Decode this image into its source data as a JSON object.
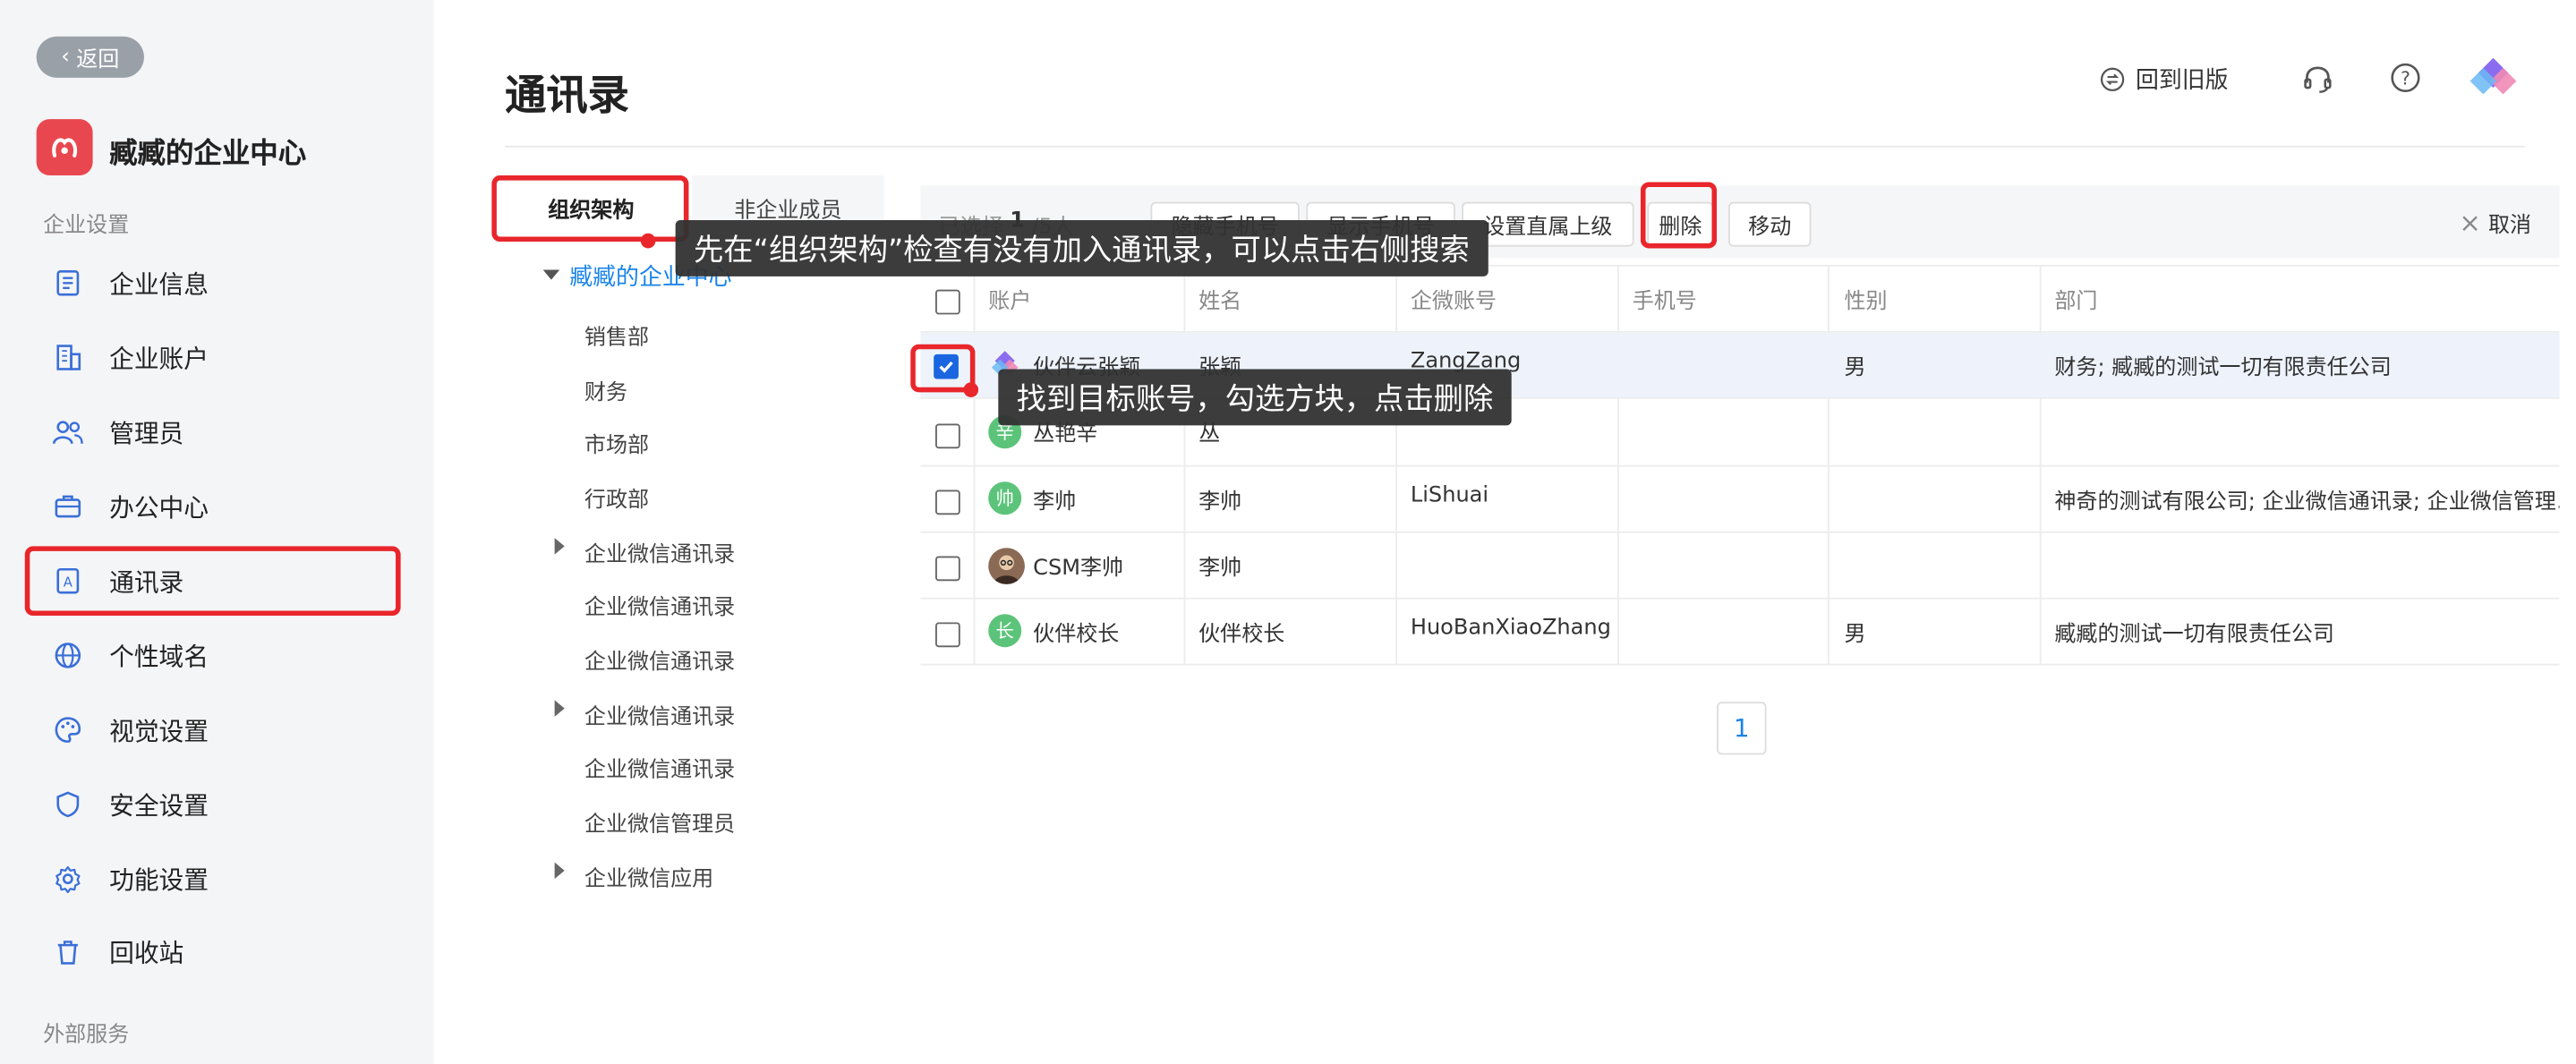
{
  "sidebar": {
    "back_label": "返回",
    "org_name": "臧臧的企业中心",
    "section_settings": "企业设置",
    "section_external": "外部服务",
    "items": [
      {
        "label": "企业信息",
        "icon": "document-icon"
      },
      {
        "label": "企业账户",
        "icon": "building-icon"
      },
      {
        "label": "管理员",
        "icon": "users-icon"
      },
      {
        "label": "办公中心",
        "icon": "briefcase-icon"
      },
      {
        "label": "通讯录",
        "icon": "contacts-book-icon",
        "active": true
      },
      {
        "label": "个性域名",
        "icon": "globe-icon"
      },
      {
        "label": "视觉设置",
        "icon": "palette-icon"
      },
      {
        "label": "安全设置",
        "icon": "shield-icon"
      },
      {
        "label": "功能设置",
        "icon": "gear-icon"
      },
      {
        "label": "回收站",
        "icon": "trash-icon"
      }
    ]
  },
  "header": {
    "title": "通讯录",
    "legacy_label": "回到旧版",
    "icons": [
      "swap-icon",
      "headset-icon",
      "help-icon",
      "app-logo-icon"
    ]
  },
  "tree": {
    "tabs": [
      "组织架构",
      "非企业成员"
    ],
    "root": "臧臧的企业中心",
    "nodes": [
      "销售部",
      "财务",
      "市场部",
      "行政部",
      "企业微信通讯录",
      "企业微信通讯录",
      "企业微信通讯录",
      "企业微信通讯录",
      "企业微信通讯录",
      "企业微信管理员",
      "企业微信应用"
    ]
  },
  "toolbar": {
    "selected_prefix": "已选择",
    "selected_count": "1",
    "selected_total": "/5人",
    "buttons": [
      "隐藏手机号",
      "显示手机号",
      "设置直属上级",
      "删除",
      "移动"
    ],
    "cancel": "取消"
  },
  "table": {
    "columns": [
      "账户",
      "姓名",
      "企微账号",
      "手机号",
      "性别",
      "部门"
    ],
    "rows": [
      {
        "account": "伙伴云张颖",
        "avatar": "",
        "name": "张颖",
        "wecom": "ZangZang",
        "phone": "",
        "gender": "男",
        "dept": "财务; 臧臧的测试一切有限责任公司",
        "checked": true
      },
      {
        "account": "丛艳辛",
        "avatar": "辛",
        "name": "丛",
        "wecom": "",
        "phone": "",
        "gender": "",
        "dept": "",
        "checked": false
      },
      {
        "account": "李帅",
        "avatar": "帅",
        "name": "李帅",
        "wecom": "LiShuai",
        "phone": "",
        "gender": "",
        "dept": "神奇的测试有限公司; 企业微信通讯录; 企业微信管理…",
        "checked": false
      },
      {
        "account": "CSM李帅",
        "avatar": "",
        "name": "李帅",
        "wecom": "",
        "phone": "",
        "gender": "",
        "dept": "",
        "checked": false
      },
      {
        "account": "伙伴校长",
        "avatar": "长",
        "name": "伙伴校长",
        "wecom": "HuoBanXiaoZhang",
        "phone": "",
        "gender": "男",
        "dept": "臧臧的测试一切有限责任公司",
        "checked": false
      }
    ]
  },
  "pagination": {
    "current": "1"
  },
  "annotations": {
    "tip_org": "先在“组织架构”检查有没有加入通讯录，可以点击右侧搜索",
    "tip_select": "找到目标账号，勾选方块，点击删除"
  },
  "colors": {
    "accent": "#1a84e8",
    "highlight": "#e8262b",
    "logo": "#e9474f",
    "avatar_green": "#5cc47a"
  }
}
